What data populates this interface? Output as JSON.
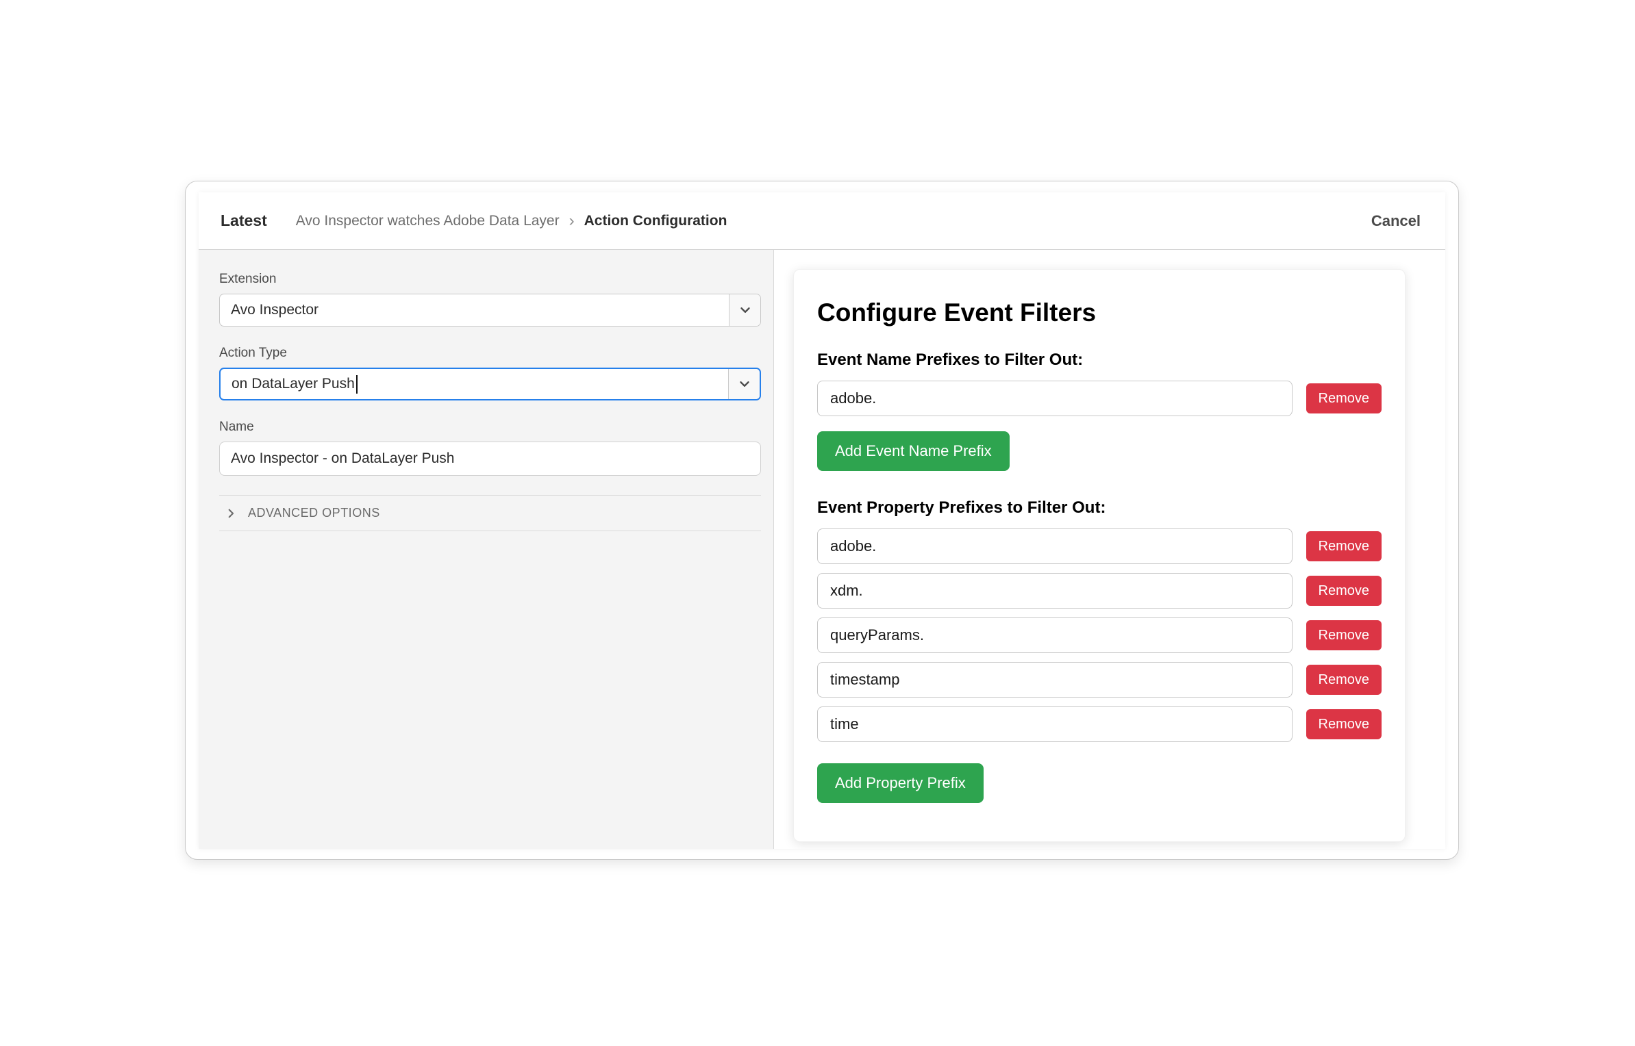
{
  "header": {
    "environment": "Latest",
    "breadcrumb_parent": "Avo Inspector watches Adobe Data Layer",
    "breadcrumb_separator": "›",
    "breadcrumb_current": "Action Configuration",
    "cancel_label": "Cancel"
  },
  "left_panel": {
    "extension": {
      "label": "Extension",
      "value": "Avo Inspector"
    },
    "action_type": {
      "label": "Action Type",
      "value": "on DataLayer Push"
    },
    "name": {
      "label": "Name",
      "value": "Avo Inspector - on DataLayer Push"
    },
    "advanced_options_label": "ADVANCED OPTIONS"
  },
  "filters_card": {
    "title": "Configure Event Filters",
    "event_name_section": {
      "label": "Event Name Prefixes to Filter Out:",
      "prefixes": [
        "adobe."
      ],
      "remove_label": "Remove",
      "add_button_label": "Add Event Name Prefix"
    },
    "event_property_section": {
      "label": "Event Property Prefixes to Filter Out:",
      "prefixes": [
        "adobe.",
        "xdm.",
        "queryParams.",
        "timestamp",
        "time"
      ],
      "remove_label": "Remove",
      "add_button_label": "Add Property Prefix"
    }
  },
  "colors": {
    "accent_blue": "#2680eb",
    "danger_red": "#dc3545",
    "success_green": "#2ea44f",
    "left_panel_gray": "#f4f4f4"
  },
  "icons": {
    "select_chevron": "chevron-down",
    "advanced_chevron": "chevron-right"
  }
}
